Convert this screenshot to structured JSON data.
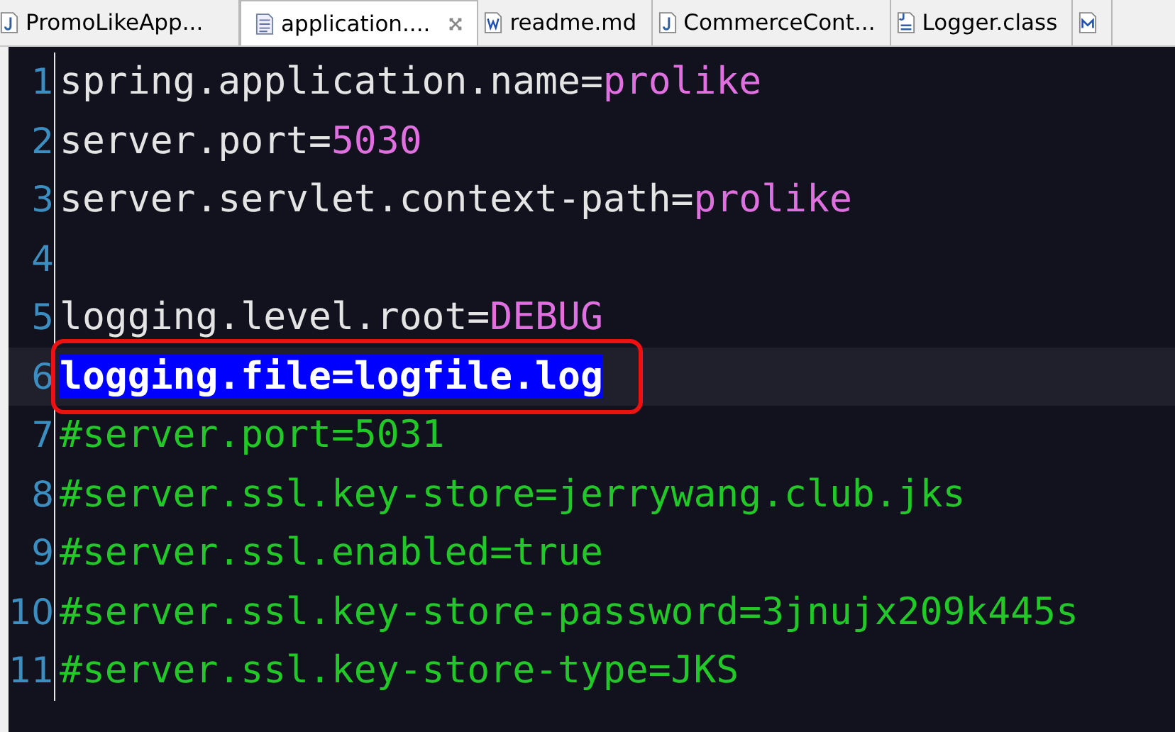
{
  "tabs": [
    {
      "label": "PromoLikeApp...",
      "kind": "java",
      "selected": false
    },
    {
      "label": "application....",
      "kind": "text",
      "selected": true
    },
    {
      "label": "readme.md",
      "kind": "word",
      "selected": false
    },
    {
      "label": "CommerceCont...",
      "kind": "java",
      "selected": false
    },
    {
      "label": "Logger.class",
      "kind": "class",
      "selected": false
    },
    {
      "kind": "markdown",
      "selected": false
    }
  ],
  "lines": [
    {
      "number": "1",
      "kind": "property",
      "key": "spring.application.name=",
      "value": "prolike"
    },
    {
      "number": "2",
      "kind": "property",
      "key": "server.port=",
      "value": "5030"
    },
    {
      "number": "3",
      "kind": "property",
      "key": "server.servlet.context-path=",
      "value": "prolike"
    },
    {
      "number": "4",
      "kind": "blank"
    },
    {
      "number": "5",
      "kind": "property",
      "key": "logging.level.root=",
      "value": "DEBUG"
    },
    {
      "number": "6",
      "kind": "selected",
      "text": "logging.file=logfile.log"
    },
    {
      "number": "7",
      "kind": "comment",
      "text": "#server.port=5031"
    },
    {
      "number": "8",
      "kind": "comment",
      "text": "#server.ssl.key-store=jerrywang.club.jks"
    },
    {
      "number": "9",
      "kind": "comment",
      "text": "#server.ssl.enabled=true"
    },
    {
      "number": "10",
      "kind": "comment",
      "text": "#server.ssl.key-store-password=3jnujx209k445s"
    },
    {
      "number": "11",
      "kind": "comment",
      "text": "#server.ssl.key-store-type=JKS"
    }
  ]
}
